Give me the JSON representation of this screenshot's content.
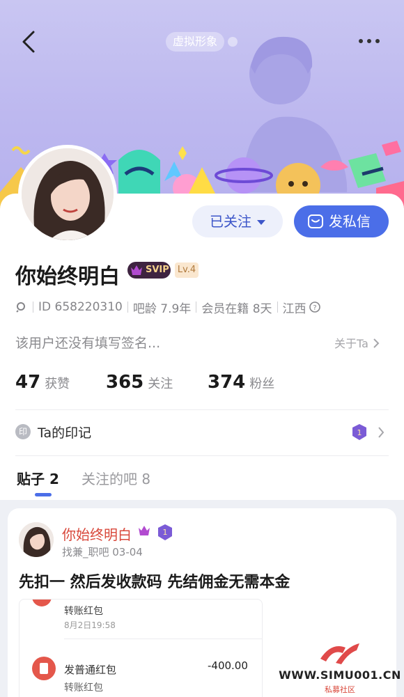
{
  "header": {
    "virtual_badge": "虚拟形象"
  },
  "profile": {
    "name": "你始终明白",
    "svip_label": "SVIP",
    "level_label": "Lv.4",
    "follow_button": "已关注",
    "message_button": "发私信",
    "id_text": "ID 658220310",
    "bar_age": "吧龄 7.9年",
    "member_days": "会员在籍 8天",
    "location": "江西",
    "signature": "该用户还没有填写签名...",
    "about_link": "关于Ta"
  },
  "stats": {
    "likes_num": "47",
    "likes_label": "获赞",
    "following_num": "365",
    "following_label": "关注",
    "fans_num": "374",
    "fans_label": "粉丝"
  },
  "seal": {
    "icon_text": "印",
    "label": "Ta的印记"
  },
  "tabs": {
    "posts": "贴子 2",
    "bars": "关注的吧 8"
  },
  "post": {
    "author": "你始终明白",
    "sub": "找兼_职吧   03-04",
    "title": "先扣一 然后发收款码 先结佣金无需本金",
    "screenshot": {
      "line1": "转账红包",
      "time1": "8月2日19:58",
      "line2": "发普通红包",
      "amount": "-400.00",
      "line3": "转账红包"
    }
  },
  "watermark": {
    "text": "WWW.SIMU001.CN",
    "sub": "私募社区"
  },
  "colors": {
    "accent": "#4b6ee8",
    "header_bg": "#c9c6f2",
    "name_red": "#d9483b"
  }
}
